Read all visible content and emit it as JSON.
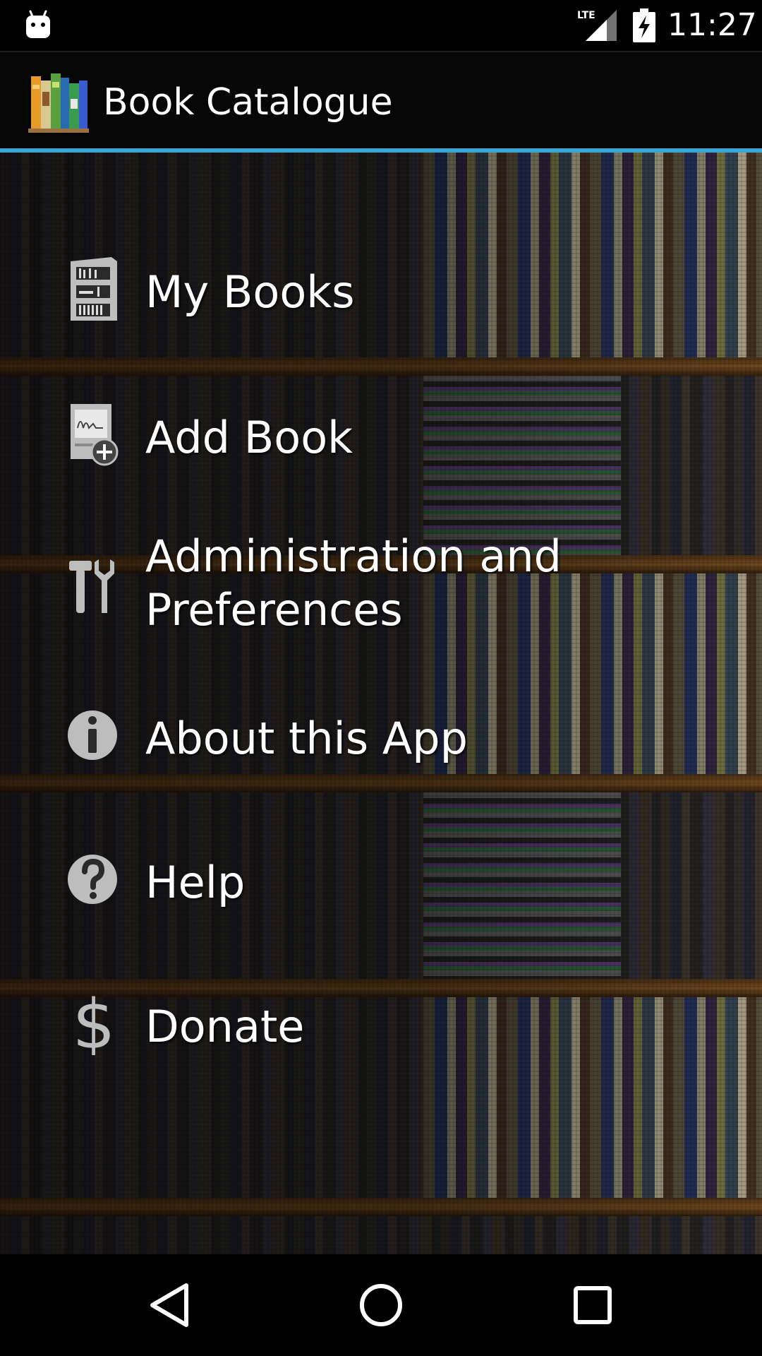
{
  "status_bar": {
    "time": "11:27",
    "network": "LTE"
  },
  "action_bar": {
    "title": "Book Catalogue",
    "accent_color": "#3aa6d4"
  },
  "menu": {
    "items": [
      {
        "label": "My Books",
        "icon": "bookshelf-icon"
      },
      {
        "label": "Add Book",
        "icon": "add-book-icon"
      },
      {
        "label_line1": "Administration and",
        "label_line2": "Preferences",
        "icon": "tools-icon"
      },
      {
        "label": "About this App",
        "icon": "info-icon"
      },
      {
        "label": "Help",
        "icon": "help-icon"
      },
      {
        "label": "Donate",
        "icon": "dollar-icon"
      }
    ]
  },
  "nav_bar": {
    "buttons": [
      "back",
      "home",
      "recents"
    ]
  }
}
